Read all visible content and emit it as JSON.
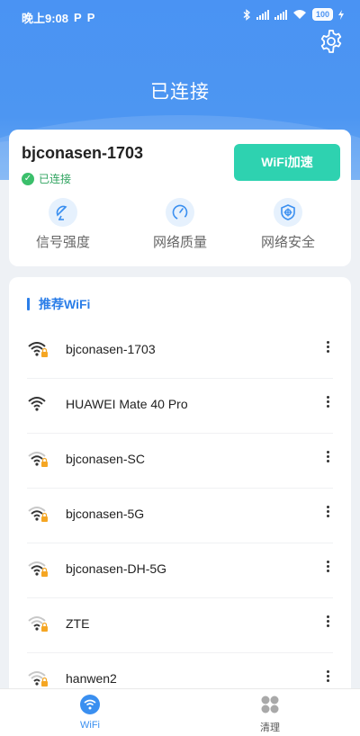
{
  "status_bar": {
    "time": "晚上9:08",
    "p_icons": [
      "P",
      "P"
    ],
    "battery": "100"
  },
  "header": {
    "title": "已连接"
  },
  "connection": {
    "ssid": "bjconasen-1703",
    "status": "已连接",
    "boost_button": "WiFi加速",
    "features": [
      {
        "label": "信号强度",
        "icon": "satellite-icon"
      },
      {
        "label": "网络质量",
        "icon": "speedometer-icon"
      },
      {
        "label": "网络安全",
        "icon": "shield-icon"
      }
    ]
  },
  "recommended": {
    "title": "推荐WiFi",
    "networks": [
      {
        "name": "bjconasen-1703",
        "signal": "strong"
      },
      {
        "name": "HUAWEI Mate 40 Pro",
        "signal": "strong"
      },
      {
        "name": "bjconasen-SC",
        "signal": "medium"
      },
      {
        "name": "bjconasen-5G",
        "signal": "medium"
      },
      {
        "name": "bjconasen-DH-5G",
        "signal": "medium"
      },
      {
        "name": "ZTE",
        "signal": "weak"
      },
      {
        "name": "hanwen2",
        "signal": "weak"
      }
    ]
  },
  "tabs": [
    {
      "label": "WiFi",
      "active": true,
      "icon": "wifi-icon"
    },
    {
      "label": "清理",
      "active": false,
      "icon": "grid-icon"
    }
  ],
  "colors": {
    "brand_blue": "#4a93f3",
    "accent_teal": "#2ed2b0",
    "success_green": "#3bbf6b",
    "lock_orange": "#f5a623"
  }
}
